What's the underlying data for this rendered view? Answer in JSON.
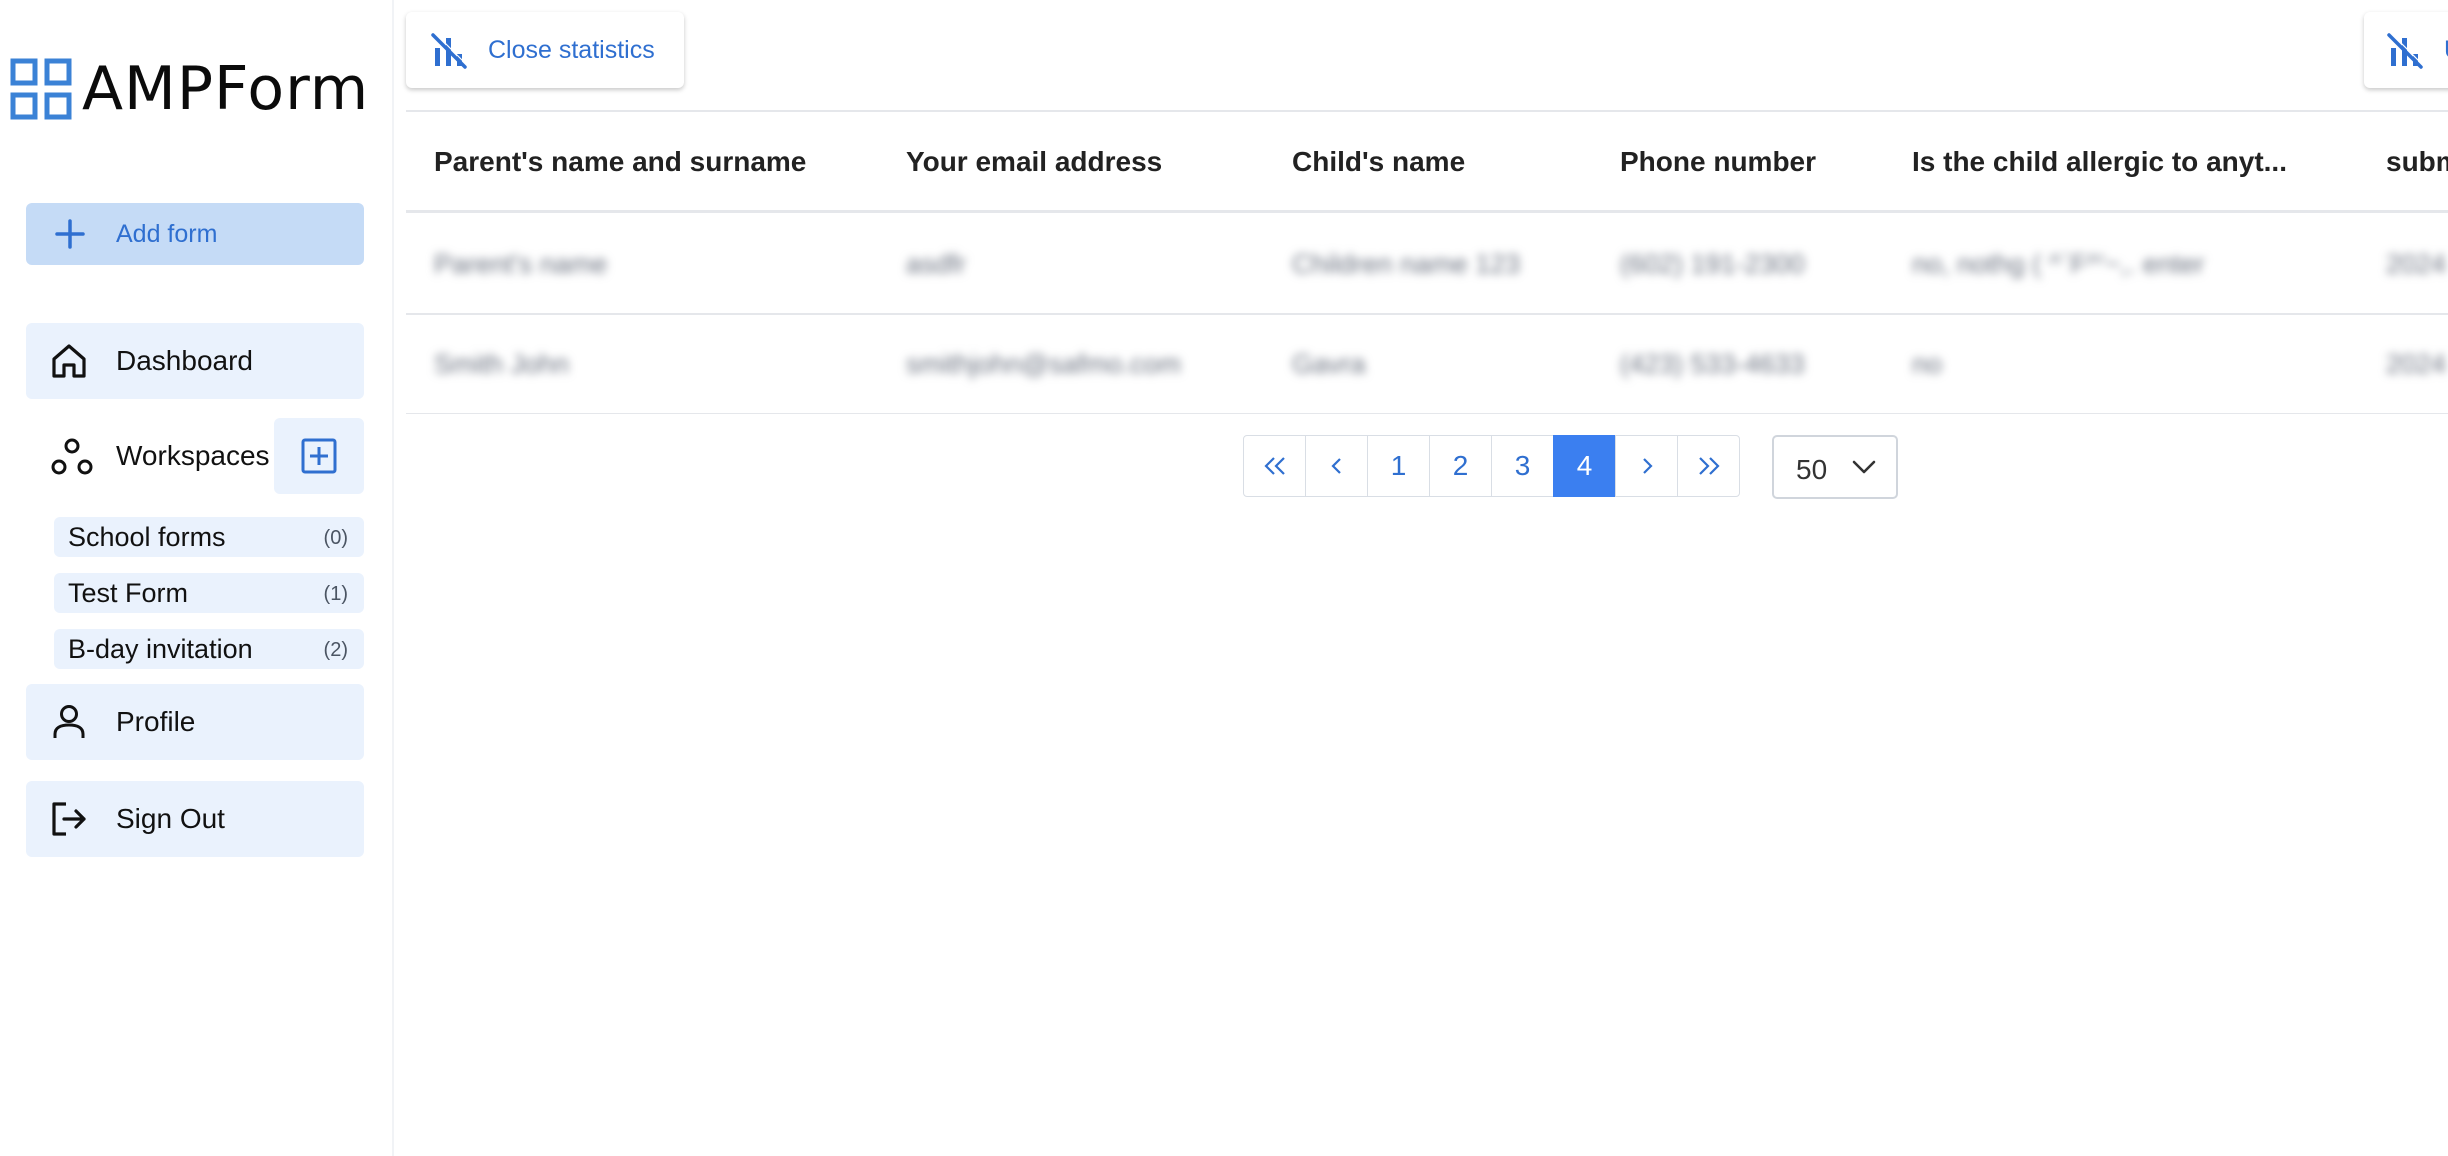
{
  "app": {
    "name": "AMPForm"
  },
  "sidebar": {
    "add_form_label": "Add form",
    "nav": {
      "dashboard": "Dashboard",
      "workspaces": "Workspaces",
      "profile": "Profile",
      "sign_out": "Sign Out"
    },
    "workspaces": [
      {
        "name": "School forms",
        "count": "(0)"
      },
      {
        "name": "Test Form",
        "count": "(1)"
      },
      {
        "name": "B-day invitation",
        "count": "(2)"
      }
    ]
  },
  "toolbar": {
    "close_statistics_label": "Close statistics",
    "second_button_partial_label": "U"
  },
  "table": {
    "columns": [
      "Parent's name and surname",
      "Your email address",
      "Child's name",
      "Phone number",
      "Is the child allergic to anyt...",
      "subm"
    ],
    "rows": [
      [
        "Parent's name",
        "asdfr",
        "Children name 123",
        "(602) 191-2300",
        "no, nothg ( ^`F^'~,. enter",
        "2024"
      ],
      [
        "Smith John",
        "smithjohn@safmo.com",
        "Gavra",
        "(423) 533-4633",
        "no",
        "2024"
      ]
    ]
  },
  "pagination": {
    "pages": [
      "1",
      "2",
      "3",
      "4"
    ],
    "active_page": "4",
    "per_page": "50"
  },
  "colors": {
    "accent": "#3b7ff0",
    "accent_text": "#2f6fd0",
    "nav_bg": "#eaf2fd",
    "add_form_bg": "#c5dbf6",
    "logo_blue": "#3b82d6"
  }
}
